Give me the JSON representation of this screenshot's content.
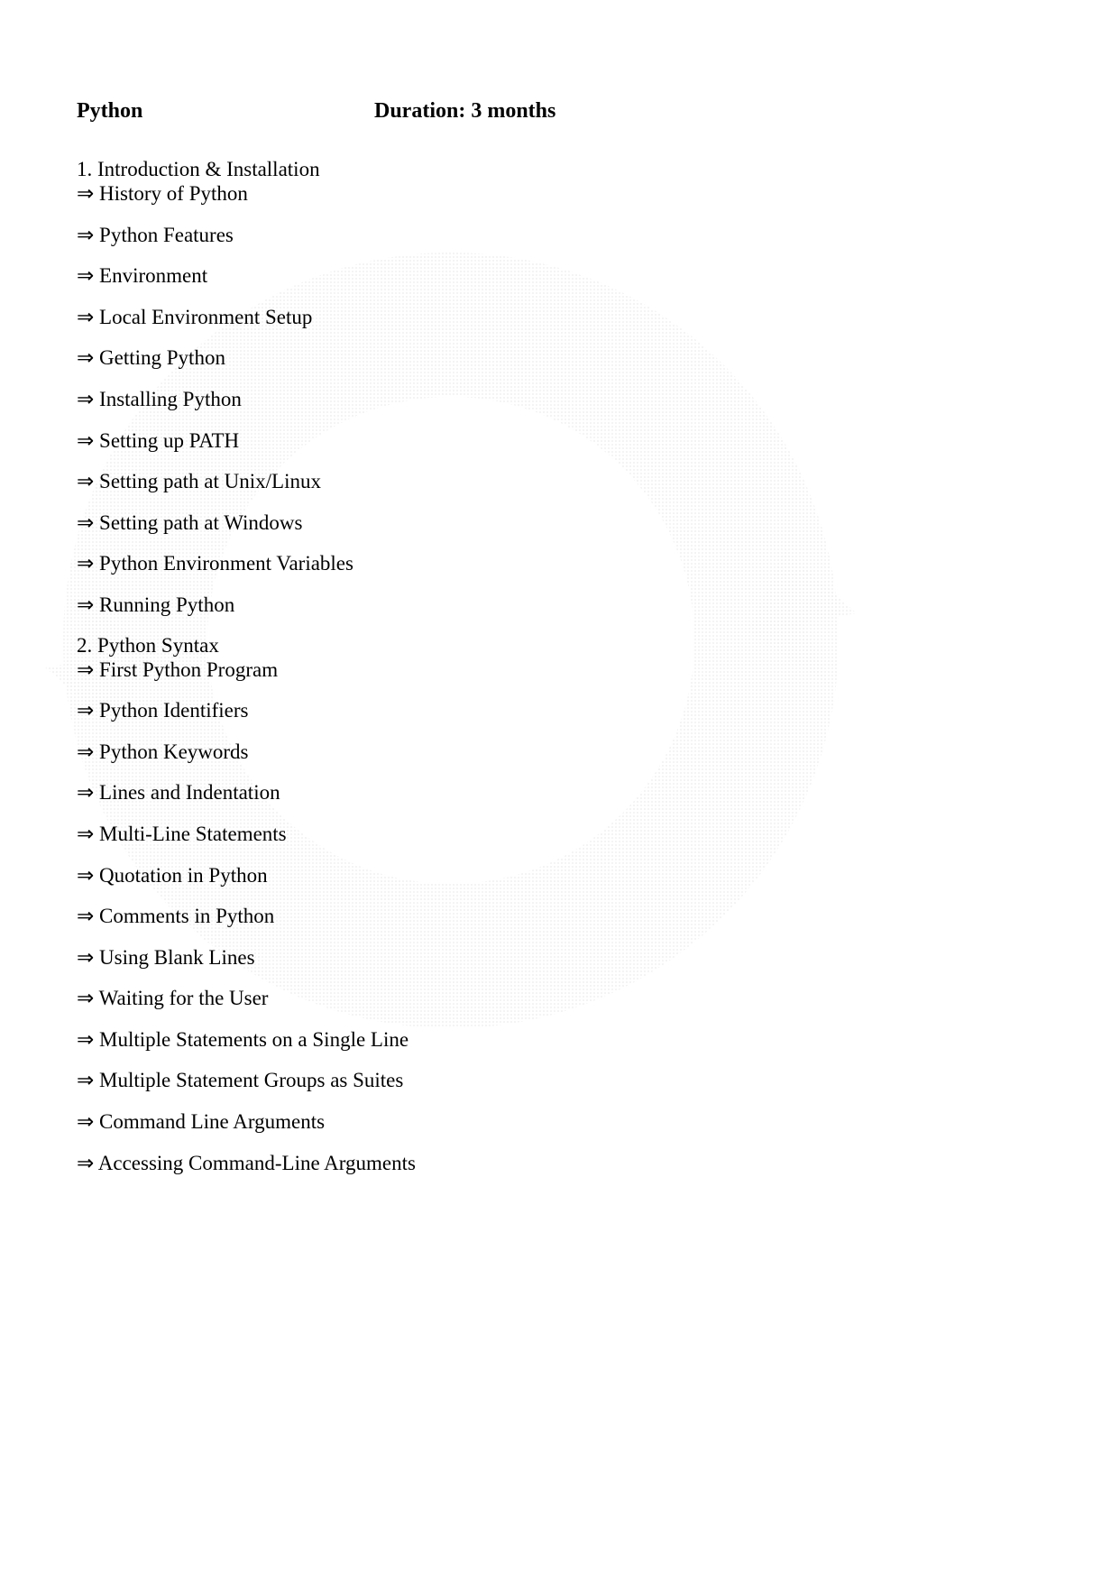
{
  "header": {
    "title": "Python",
    "duration": "Duration: 3 months"
  },
  "sections": [
    {
      "number": "1",
      "title": "Introduction & Installation",
      "items": [
        "History of Python",
        "Python Features",
        "Environment",
        "Local Environment Setup",
        "Getting Python",
        "Installing Python",
        "Setting up PATH",
        "Setting path at Unix/Linux",
        "Setting path at Windows",
        "Python Environment Variables",
        "Running Python"
      ]
    },
    {
      "number": "2",
      "title": "Python Syntax",
      "items": [
        "First Python Program",
        "Python Identifiers",
        "Python Keywords",
        "Lines and Indentation",
        "Multi-Line Statements",
        "Quotation in Python",
        "Comments in Python",
        "Using Blank Lines",
        "Waiting for the User",
        "Multiple Statements on a Single Line",
        "Multiple Statement Groups as Suites",
        "Command Line Arguments",
        "Accessing Command-Line Arguments"
      ]
    }
  ]
}
